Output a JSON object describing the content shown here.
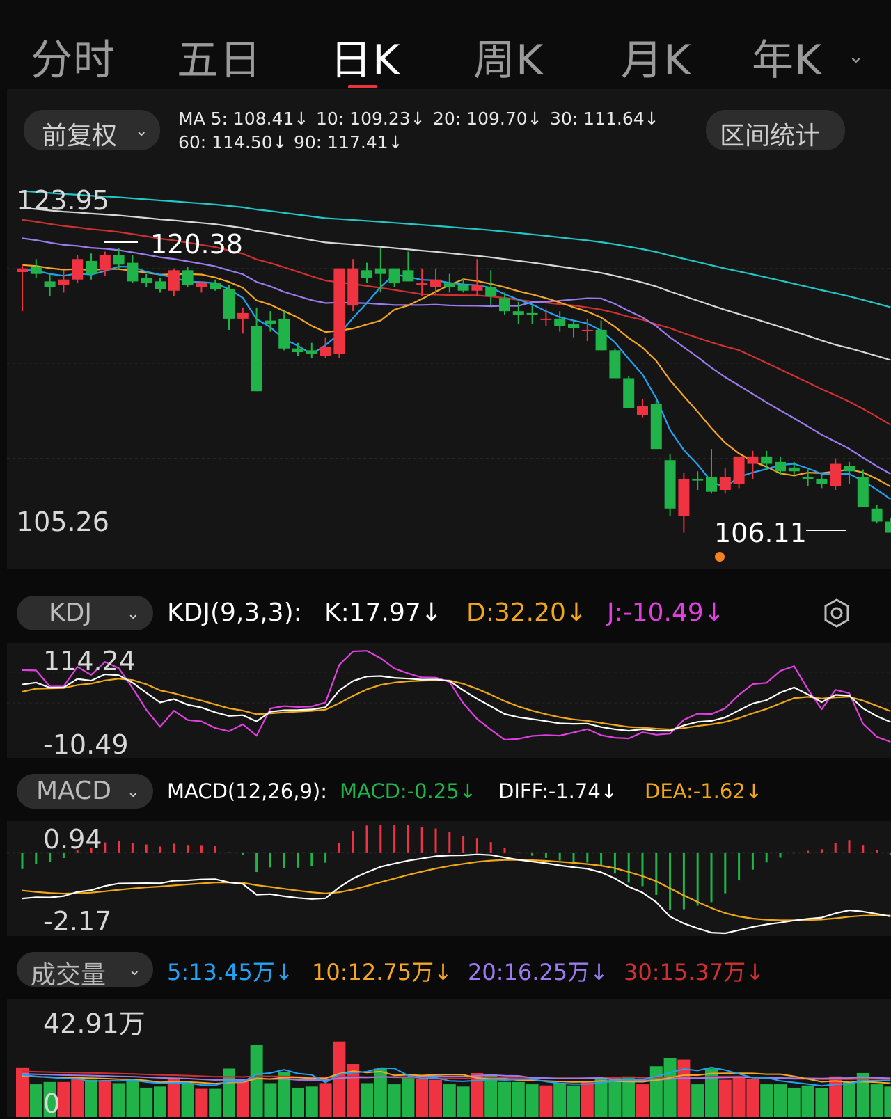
{
  "tabs": [
    {
      "label": "分时",
      "active": false
    },
    {
      "label": "五日",
      "active": false
    },
    {
      "label": "日K",
      "active": true
    },
    {
      "label": "周K",
      "active": false
    },
    {
      "label": "月K",
      "active": false
    },
    {
      "label": "年K",
      "active": false
    }
  ],
  "colors": {
    "up": "#ef3340",
    "down": "#1fb34a",
    "ma5": "#22a4f5",
    "ma10": "#f5a623",
    "ma20": "#9b7bf0",
    "ma30": "#d03030",
    "ma60": "#d8d8d8",
    "ma90": "#20c8c8",
    "k": "#ffffff",
    "d": "#f0a818",
    "j": "#e040e0"
  },
  "price_panel": {
    "adjust_label": "前复权",
    "range_stats_label": "区间统计",
    "ma": [
      {
        "label": "MA 5: 108.41↓",
        "color": "#22a4f5"
      },
      {
        "label": "10: 109.23↓",
        "color": "#f5a623"
      },
      {
        "label": "20: 109.70↓",
        "color": "#9b7bf0"
      },
      {
        "label": "30: 111.64↓",
        "color": "#d03030"
      },
      {
        "label": "60: 114.50↓",
        "color": "#d8d8d8"
      },
      {
        "label": "90: 117.41↓",
        "color": "#20c8c8"
      }
    ],
    "axis_high": "123.95",
    "axis_low": "105.26",
    "high_annotation": "120.38",
    "low_annotation": "106.11"
  },
  "kdj_panel": {
    "selector": "KDJ",
    "params": "KDJ(9,3,3):",
    "k": "K:17.97↓",
    "d": "D:32.20↓",
    "j": "J:-10.49↓",
    "axis_high": "114.24",
    "axis_low": "-10.49"
  },
  "macd_panel": {
    "selector": "MACD",
    "params": "MACD(12,26,9):",
    "macd": "MACD:-0.25↓",
    "diff": "DIFF:-1.74↓",
    "dea": "DEA:-1.62↓",
    "axis_high": "0.94",
    "axis_low": "-2.17"
  },
  "volume_panel": {
    "selector": "成交量",
    "ma5": "5:13.45万↓",
    "ma10": "10:12.75万↓",
    "ma20": "20:16.25万↓",
    "ma30": "30:15.37万↓",
    "axis_high": "42.91万",
    "axis_low": "0"
  },
  "chart_data": [
    {
      "type": "candlestick",
      "series": [
        {
          "name": "K",
          "ohlc": [
            [
              120.1,
              120.5,
              118.0,
              120.3
            ],
            [
              120.4,
              120.8,
              119.8,
              120.0
            ],
            [
              119.6,
              120.0,
              118.8,
              119.3
            ],
            [
              119.4,
              120.2,
              119.0,
              119.7
            ],
            [
              119.7,
              121.0,
              119.5,
              120.8
            ],
            [
              120.7,
              121.1,
              119.7,
              120.0
            ],
            [
              120.2,
              121.2,
              119.9,
              121.0
            ],
            [
              121.0,
              121.4,
              120.3,
              120.5
            ],
            [
              120.6,
              121.0,
              119.5,
              119.6
            ],
            [
              119.8,
              120.0,
              119.3,
              119.5
            ],
            [
              119.6,
              119.8,
              119.0,
              119.2
            ],
            [
              119.1,
              120.3,
              118.8,
              120.2
            ],
            [
              120.2,
              120.4,
              119.3,
              119.4
            ],
            [
              119.3,
              119.6,
              119.0,
              119.5
            ],
            [
              119.5,
              119.7,
              119.1,
              119.2
            ],
            [
              119.2,
              119.4,
              117.0,
              117.6
            ],
            [
              117.6,
              118.2,
              116.8,
              117.9
            ],
            [
              117.2,
              118.2,
              113.7,
              113.7
            ],
            [
              117.5,
              118.0,
              116.9,
              117.3
            ],
            [
              117.6,
              118.0,
              115.9,
              116.0
            ],
            [
              116.0,
              116.3,
              115.6,
              115.8
            ],
            [
              115.9,
              116.3,
              115.5,
              115.7
            ],
            [
              115.6,
              116.6,
              115.5,
              116.1
            ],
            [
              115.7,
              120.3,
              115.5,
              120.3
            ],
            [
              118.3,
              120.8,
              118.0,
              120.3
            ],
            [
              120.2,
              120.6,
              119.5,
              119.8
            ],
            [
              120.3,
              121.4,
              119.0,
              120.0
            ],
            [
              120.3,
              120.3,
              119.3,
              119.5
            ],
            [
              120.2,
              121.2,
              119.6,
              119.6
            ],
            [
              119.5,
              120.3,
              118.8,
              119.5
            ],
            [
              119.3,
              120.3,
              118.9,
              119.7
            ],
            [
              119.5,
              120.0,
              119.0,
              119.3
            ],
            [
              119.4,
              119.8,
              119.0,
              119.1
            ],
            [
              119.1,
              120.8,
              118.8,
              119.4
            ],
            [
              119.3,
              120.2,
              118.3,
              118.8
            ],
            [
              118.7,
              119.0,
              117.8,
              118.0
            ],
            [
              118.0,
              118.5,
              117.3,
              117.8
            ],
            [
              117.9,
              118.3,
              117.3,
              117.8
            ],
            [
              117.6,
              118.1,
              117.2,
              117.6
            ],
            [
              117.6,
              118.0,
              116.9,
              117.2
            ],
            [
              117.3,
              117.5,
              116.6,
              117.1
            ],
            [
              117.0,
              117.6,
              116.4,
              117.0
            ],
            [
              117.0,
              117.5,
              115.9,
              115.9
            ],
            [
              115.9,
              116.0,
              114.4,
              114.4
            ],
            [
              114.4,
              114.5,
              112.8,
              112.8
            ],
            [
              112.4,
              113.3,
              112.3,
              112.9
            ],
            [
              113.0,
              113.2,
              110.6,
              110.6
            ],
            [
              110.0,
              110.3,
              107.0,
              107.4
            ],
            [
              107.0,
              109.3,
              106.1,
              109.0
            ],
            [
              109.0,
              109.4,
              108.4,
              108.9
            ],
            [
              109.1,
              110.6,
              108.2,
              108.3
            ],
            [
              108.4,
              109.6,
              108.2,
              109.1
            ],
            [
              108.7,
              110.1,
              108.5,
              110.2
            ],
            [
              109.8,
              110.5,
              109.0,
              110.2
            ],
            [
              110.2,
              110.5,
              109.5,
              109.8
            ],
            [
              109.9,
              110.2,
              109.2,
              109.4
            ],
            [
              109.6,
              109.9,
              109.2,
              109.4
            ],
            [
              109.1,
              109.5,
              108.6,
              109.0
            ],
            [
              109.0,
              109.2,
              108.5,
              108.7
            ],
            [
              108.6,
              110.1,
              108.4,
              109.8
            ],
            [
              109.7,
              109.9,
              108.7,
              109.4
            ],
            [
              109.1,
              109.5,
              107.5,
              107.5
            ],
            [
              107.4,
              107.6,
              106.6,
              106.7
            ],
            [
              106.7,
              106.9,
              106.1,
              106.1
            ]
          ]
        }
      ]
    }
  ]
}
